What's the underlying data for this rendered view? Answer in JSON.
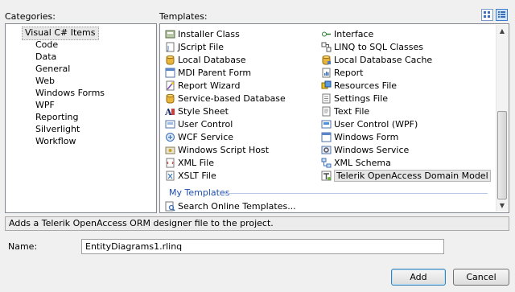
{
  "categories_label": "Categories:",
  "templates_label": "Templates:",
  "categories": [
    {
      "label": "Visual C# Items",
      "selected": true,
      "level": 0
    },
    {
      "label": "Code",
      "level": 1
    },
    {
      "label": "Data",
      "level": 1
    },
    {
      "label": "General",
      "level": 1
    },
    {
      "label": "Web",
      "level": 1
    },
    {
      "label": "Windows Forms",
      "level": 1
    },
    {
      "label": "WPF",
      "level": 1
    },
    {
      "label": "Reporting",
      "level": 1
    },
    {
      "label": "Silverlight",
      "level": 1
    },
    {
      "label": "Workflow",
      "level": 1
    }
  ],
  "templates_left": [
    {
      "label": "Installer Class",
      "icon": "installer-icon"
    },
    {
      "label": "JScript File",
      "icon": "jscript-icon"
    },
    {
      "label": "Local Database",
      "icon": "database-icon"
    },
    {
      "label": "MDI Parent Form",
      "icon": "form-icon"
    },
    {
      "label": "Report Wizard",
      "icon": "wizard-icon"
    },
    {
      "label": "Service-based Database",
      "icon": "database-icon"
    },
    {
      "label": "Style Sheet",
      "icon": "stylesheet-icon"
    },
    {
      "label": "User Control",
      "icon": "user-control-icon"
    },
    {
      "label": "WCF Service",
      "icon": "wcf-icon"
    },
    {
      "label": "Windows Script Host",
      "icon": "script-host-icon"
    },
    {
      "label": "XML File",
      "icon": "xml-file-icon"
    },
    {
      "label": "XSLT File",
      "icon": "xslt-icon"
    }
  ],
  "templates_right": [
    {
      "label": "Interface",
      "icon": "interface-icon"
    },
    {
      "label": "LINQ to SQL Classes",
      "icon": "linq-icon"
    },
    {
      "label": "Local Database Cache",
      "icon": "database-cache-icon"
    },
    {
      "label": "Report",
      "icon": "report-icon"
    },
    {
      "label": "Resources File",
      "icon": "resources-icon"
    },
    {
      "label": "Settings File",
      "icon": "settings-icon"
    },
    {
      "label": "Text File",
      "icon": "text-file-icon"
    },
    {
      "label": "User Control (WPF)",
      "icon": "wpf-control-icon"
    },
    {
      "label": "Windows Form",
      "icon": "form-icon"
    },
    {
      "label": "Windows Service",
      "icon": "service-icon"
    },
    {
      "label": "XML Schema",
      "icon": "schema-icon"
    },
    {
      "label": "Telerik OpenAccess Domain Model",
      "icon": "telerik-icon",
      "selected": true
    }
  ],
  "my_templates": {
    "heading": "My Templates",
    "items": [
      {
        "label": "Search Online Templates...",
        "icon": "search-online-icon"
      }
    ]
  },
  "description": "Adds a Telerik OpenAccess ORM designer file to the project.",
  "name_label": "Name:",
  "name_value": "EntityDiagrams1.rlinq",
  "buttons": {
    "add": "Add",
    "cancel": "Cancel"
  },
  "colors": {
    "section_heading": "#1f4fb0",
    "panel_border": "#828790",
    "dialog_bg": "#f0f0f0"
  }
}
